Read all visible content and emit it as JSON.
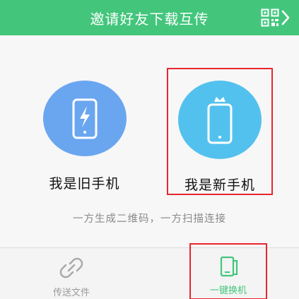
{
  "header": {
    "title": "邀请好友下载互传",
    "qr_icon": "qr-code-icon",
    "chevron_icon": "chevron-right-icon"
  },
  "options": {
    "old_phone": {
      "label": "我是旧手机",
      "icon": "phone-charging-icon",
      "color": "#6aa6f0"
    },
    "new_phone": {
      "label": "我是新手机",
      "icon": "phone-crown-icon",
      "color": "#53c1ee"
    }
  },
  "hint": "一方生成二维码，一方扫描连接",
  "tabs": {
    "transfer": {
      "label": "传送文件",
      "icon": "link-icon",
      "active": false
    },
    "switch": {
      "label": "一键换机",
      "icon": "phone-switch-icon",
      "active": true
    }
  },
  "colors": {
    "accent": "#43c67c",
    "highlight_box": "#e8262e"
  }
}
